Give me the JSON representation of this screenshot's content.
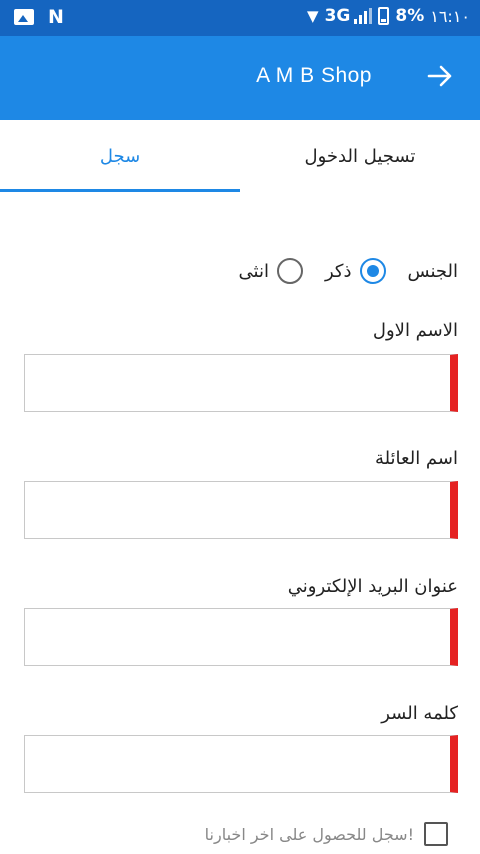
{
  "status_bar": {
    "network": "3G",
    "battery": "8%",
    "time": "١٦:١٠"
  },
  "app_bar": {
    "title": "A M B Shop"
  },
  "tabs": [
    {
      "label": "تسجيل الدخول",
      "active": false
    },
    {
      "label": "سجل",
      "active": true
    }
  ],
  "form": {
    "gender": {
      "label": "الجنس",
      "options": [
        "ذكر",
        "انثى"
      ],
      "selected": "ذكر"
    },
    "fields": [
      {
        "label": "الاسم الاول",
        "value": ""
      },
      {
        "label": "اسم العائلة",
        "value": ""
      },
      {
        "label": "عنوان البريد الإلكتروني",
        "value": ""
      },
      {
        "label": "كلمه السر",
        "value": ""
      }
    ],
    "newsletter": {
      "label": "سجل للحصول على اخر اخبارنا!",
      "checked": false
    }
  },
  "colors": {
    "status_bar": "#1565c0",
    "primary": "#1e88e5",
    "required_marker": "#e52222"
  }
}
